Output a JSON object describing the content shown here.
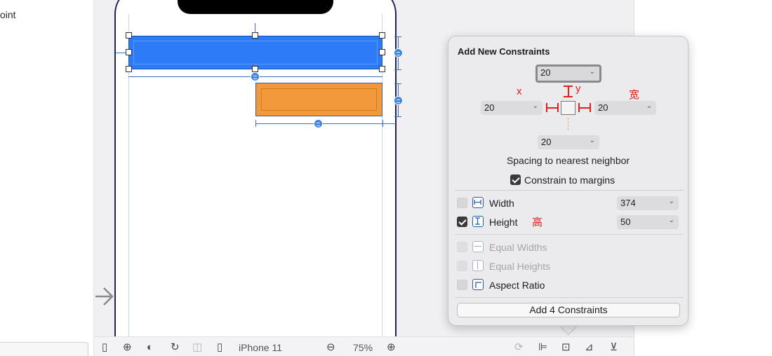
{
  "sidebar": {
    "partial_text": "oint"
  },
  "device": {
    "name": "iPhone 11",
    "zoom": "75%"
  },
  "popover": {
    "title": "Add New Constraints",
    "top_value": "20",
    "leading_value": "20",
    "trailing_value": "20",
    "bottom_value": "20",
    "annotation_x": "x",
    "annotation_y": "y",
    "annotation_width": "宽",
    "annotation_height": "高",
    "spacing_caption": "Spacing to nearest neighbor",
    "constrain_margins_label": "Constrain to margins",
    "constrain_margins_checked": true,
    "rows": [
      {
        "label": "Width",
        "checked": false,
        "value": "374",
        "enabled": true
      },
      {
        "label": "Height",
        "checked": true,
        "value": "50",
        "enabled": true
      },
      {
        "label": "Equal Widths",
        "checked": false,
        "enabled": false
      },
      {
        "label": "Equal Heights",
        "checked": false,
        "enabled": false
      },
      {
        "label": "Aspect Ratio",
        "checked": false,
        "enabled": true
      }
    ],
    "add_button_label": "Add 4 Constraints"
  },
  "icons": [
    "sidebar-toggle-icon",
    "accessibility-icon",
    "appearance-icon",
    "orientation-icon",
    "split-view-icon",
    "device-icon",
    "zoom-out-icon",
    "zoom-in-icon",
    "update-frames-icon",
    "align-icon",
    "add-constraints-icon",
    "resolve-issues-icon",
    "embed-in-icon"
  ],
  "colors": {
    "selected_view": "#2d7bf6",
    "secondary_view": "#f29a3b",
    "annotation": "#e02020",
    "constraint": "#3e84e5"
  }
}
